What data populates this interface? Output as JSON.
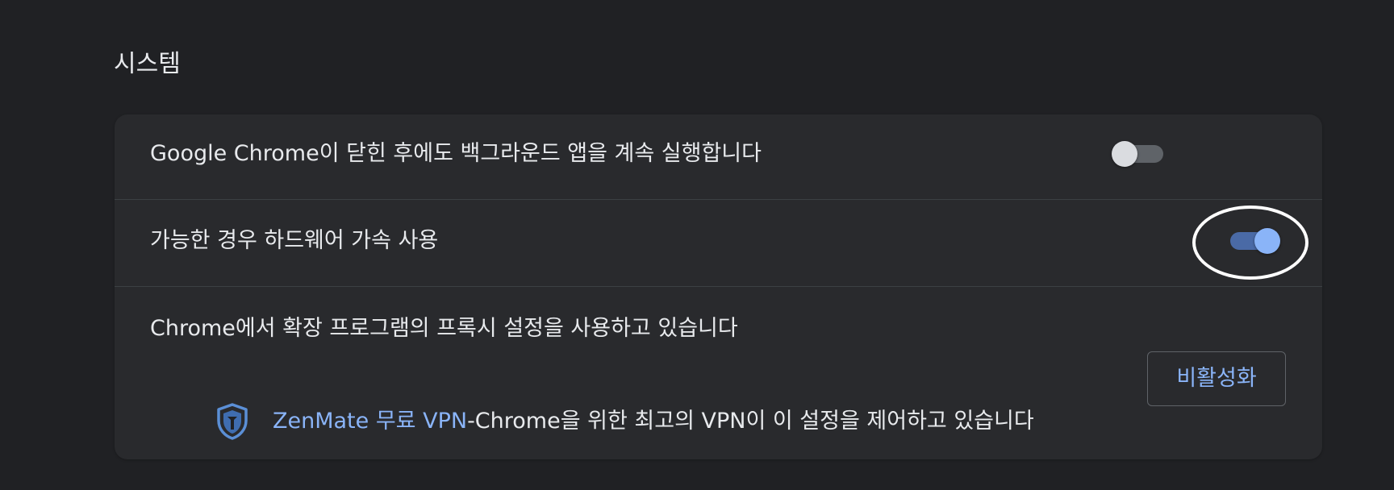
{
  "section": {
    "title": "시스템"
  },
  "settings": [
    {
      "label": "Google Chrome이 닫힌 후에도 백그라운드 앱을 계속 실행합니다",
      "enabled": false
    },
    {
      "label": "가능한 경우 하드웨어 가속 사용",
      "enabled": true
    }
  ],
  "proxy": {
    "label": "Chrome에서 확장 프로그램의 프록시 설정을 사용하고 있습니다",
    "extension_icon": "shield-icon",
    "extension_name": "ZenMate 무료 VPN",
    "control_text": "-Chrome을 위한 최고의 VPN이 이 설정을 제어하고 있습니다",
    "disable_label": "비활성화"
  },
  "colors": {
    "background": "#202124",
    "card": "#292a2d",
    "accent": "#8ab4f8",
    "toggle_on_track": "#4a6aa6",
    "toggle_off_knob": "#dadce0"
  }
}
